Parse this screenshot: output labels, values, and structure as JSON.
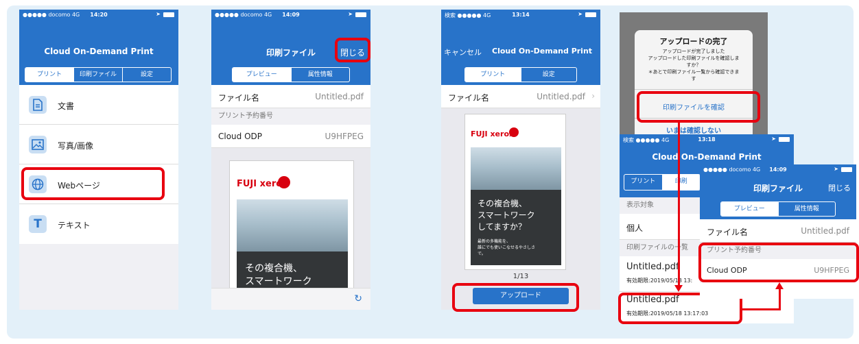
{
  "colors": {
    "accent": "#2873c9",
    "highlight": "#e8000f",
    "background": "#e3f0f9"
  },
  "screen1": {
    "status": {
      "carrier": "●●●●● docomo  4G",
      "time": "14:20"
    },
    "title": "Cloud On-Demand Print",
    "tabs": [
      "プリント",
      "印刷ファイル",
      "設定"
    ],
    "items": [
      {
        "label": "文書",
        "icon": "document-icon"
      },
      {
        "label": "写真/画像",
        "icon": "photo-icon"
      },
      {
        "label": "Webページ",
        "icon": "globe-icon"
      },
      {
        "label": "テキスト",
        "icon": "text-icon"
      }
    ]
  },
  "screen2": {
    "status": {
      "carrier": "●●●●● docomo  4G",
      "time": "14:09"
    },
    "title": "印刷ファイル",
    "close": "閉じる",
    "tabs": [
      "プレビュー",
      "属性情報"
    ],
    "file_label": "ファイル名",
    "file_value": "Untitled.pdf",
    "section": "プリント予約番号",
    "odp_label": "Cloud ODP",
    "odp_value": "U9HFPEG",
    "brand": "FUJI xerox",
    "headline": "その複合機、\nスマートワーク\nしてますか？"
  },
  "screen3": {
    "status": {
      "carrier": "検索 ●●●●●  4G",
      "time": "13:14"
    },
    "cancel": "キャンセル",
    "title": "Cloud On-Demand Print",
    "tabs": [
      "プリント",
      "設定"
    ],
    "file_label": "ファイル名",
    "file_value": "Untitled.pdf",
    "brand": "FUJI xerox",
    "headline": "その複合機、\nスマートワーク\nしてますか？",
    "subtext": "最新の多機能を、\n誰にでも使いこなせるやさしさ\nで。",
    "page": "1/13",
    "upload": "アップロード"
  },
  "dialog": {
    "title": "アップロードの完了",
    "message": "アップロードが完了しました\nアップロードした印刷ファイルを確認しま\nすか？\n＊あとで印刷ファイル一覧から確認できま\nす",
    "confirm": "印刷ファイルを確認",
    "later": "いまは確認しない"
  },
  "screen4": {
    "status": {
      "carrier": "検索 ●●●●●  4G",
      "time": "13:18"
    },
    "title": "Cloud On-Demand Print",
    "tab1": "プリント",
    "tab2": "印刷",
    "section1": "表示対象",
    "target": "個人",
    "section2": "印刷ファイルの一覧",
    "file1": "Untitled.pdf",
    "expire1": "有効期限:2019/05/18 13:",
    "file2": "Untitled.pdf",
    "expire2": "有効期限:2019/05/18 13:17:03"
  },
  "screen5": {
    "status": {
      "carrier": "●●●●● docomo  4G",
      "time": "14:09"
    },
    "title": "印刷ファイル",
    "close": "閉じる",
    "tabs": [
      "プレビュー",
      "属性情報"
    ],
    "file_label": "ファイル名",
    "file_value": "Untitled.pdf",
    "section": "プリント予約番号",
    "odp_label": "Cloud ODP",
    "odp_value": "U9HFPEG"
  }
}
